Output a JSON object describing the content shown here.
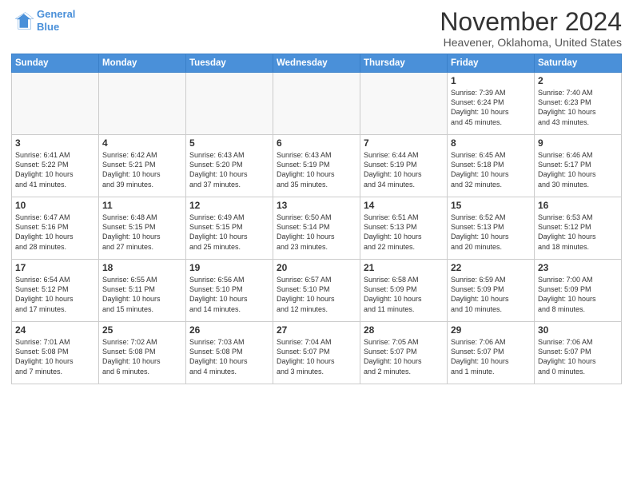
{
  "logo": {
    "line1": "General",
    "line2": "Blue"
  },
  "title": "November 2024",
  "subtitle": "Heavener, Oklahoma, United States",
  "days_header": [
    "Sunday",
    "Monday",
    "Tuesday",
    "Wednesday",
    "Thursday",
    "Friday",
    "Saturday"
  ],
  "weeks": [
    [
      {
        "day": "",
        "info": ""
      },
      {
        "day": "",
        "info": ""
      },
      {
        "day": "",
        "info": ""
      },
      {
        "day": "",
        "info": ""
      },
      {
        "day": "",
        "info": ""
      },
      {
        "day": "1",
        "info": "Sunrise: 7:39 AM\nSunset: 6:24 PM\nDaylight: 10 hours\nand 45 minutes."
      },
      {
        "day": "2",
        "info": "Sunrise: 7:40 AM\nSunset: 6:23 PM\nDaylight: 10 hours\nand 43 minutes."
      }
    ],
    [
      {
        "day": "3",
        "info": "Sunrise: 6:41 AM\nSunset: 5:22 PM\nDaylight: 10 hours\nand 41 minutes."
      },
      {
        "day": "4",
        "info": "Sunrise: 6:42 AM\nSunset: 5:21 PM\nDaylight: 10 hours\nand 39 minutes."
      },
      {
        "day": "5",
        "info": "Sunrise: 6:43 AM\nSunset: 5:20 PM\nDaylight: 10 hours\nand 37 minutes."
      },
      {
        "day": "6",
        "info": "Sunrise: 6:43 AM\nSunset: 5:19 PM\nDaylight: 10 hours\nand 35 minutes."
      },
      {
        "day": "7",
        "info": "Sunrise: 6:44 AM\nSunset: 5:19 PM\nDaylight: 10 hours\nand 34 minutes."
      },
      {
        "day": "8",
        "info": "Sunrise: 6:45 AM\nSunset: 5:18 PM\nDaylight: 10 hours\nand 32 minutes."
      },
      {
        "day": "9",
        "info": "Sunrise: 6:46 AM\nSunset: 5:17 PM\nDaylight: 10 hours\nand 30 minutes."
      }
    ],
    [
      {
        "day": "10",
        "info": "Sunrise: 6:47 AM\nSunset: 5:16 PM\nDaylight: 10 hours\nand 28 minutes."
      },
      {
        "day": "11",
        "info": "Sunrise: 6:48 AM\nSunset: 5:15 PM\nDaylight: 10 hours\nand 27 minutes."
      },
      {
        "day": "12",
        "info": "Sunrise: 6:49 AM\nSunset: 5:15 PM\nDaylight: 10 hours\nand 25 minutes."
      },
      {
        "day": "13",
        "info": "Sunrise: 6:50 AM\nSunset: 5:14 PM\nDaylight: 10 hours\nand 23 minutes."
      },
      {
        "day": "14",
        "info": "Sunrise: 6:51 AM\nSunset: 5:13 PM\nDaylight: 10 hours\nand 22 minutes."
      },
      {
        "day": "15",
        "info": "Sunrise: 6:52 AM\nSunset: 5:13 PM\nDaylight: 10 hours\nand 20 minutes."
      },
      {
        "day": "16",
        "info": "Sunrise: 6:53 AM\nSunset: 5:12 PM\nDaylight: 10 hours\nand 18 minutes."
      }
    ],
    [
      {
        "day": "17",
        "info": "Sunrise: 6:54 AM\nSunset: 5:12 PM\nDaylight: 10 hours\nand 17 minutes."
      },
      {
        "day": "18",
        "info": "Sunrise: 6:55 AM\nSunset: 5:11 PM\nDaylight: 10 hours\nand 15 minutes."
      },
      {
        "day": "19",
        "info": "Sunrise: 6:56 AM\nSunset: 5:10 PM\nDaylight: 10 hours\nand 14 minutes."
      },
      {
        "day": "20",
        "info": "Sunrise: 6:57 AM\nSunset: 5:10 PM\nDaylight: 10 hours\nand 12 minutes."
      },
      {
        "day": "21",
        "info": "Sunrise: 6:58 AM\nSunset: 5:09 PM\nDaylight: 10 hours\nand 11 minutes."
      },
      {
        "day": "22",
        "info": "Sunrise: 6:59 AM\nSunset: 5:09 PM\nDaylight: 10 hours\nand 10 minutes."
      },
      {
        "day": "23",
        "info": "Sunrise: 7:00 AM\nSunset: 5:09 PM\nDaylight: 10 hours\nand 8 minutes."
      }
    ],
    [
      {
        "day": "24",
        "info": "Sunrise: 7:01 AM\nSunset: 5:08 PM\nDaylight: 10 hours\nand 7 minutes."
      },
      {
        "day": "25",
        "info": "Sunrise: 7:02 AM\nSunset: 5:08 PM\nDaylight: 10 hours\nand 6 minutes."
      },
      {
        "day": "26",
        "info": "Sunrise: 7:03 AM\nSunset: 5:08 PM\nDaylight: 10 hours\nand 4 minutes."
      },
      {
        "day": "27",
        "info": "Sunrise: 7:04 AM\nSunset: 5:07 PM\nDaylight: 10 hours\nand 3 minutes."
      },
      {
        "day": "28",
        "info": "Sunrise: 7:05 AM\nSunset: 5:07 PM\nDaylight: 10 hours\nand 2 minutes."
      },
      {
        "day": "29",
        "info": "Sunrise: 7:06 AM\nSunset: 5:07 PM\nDaylight: 10 hours\nand 1 minute."
      },
      {
        "day": "30",
        "info": "Sunrise: 7:06 AM\nSunset: 5:07 PM\nDaylight: 10 hours\nand 0 minutes."
      }
    ]
  ]
}
